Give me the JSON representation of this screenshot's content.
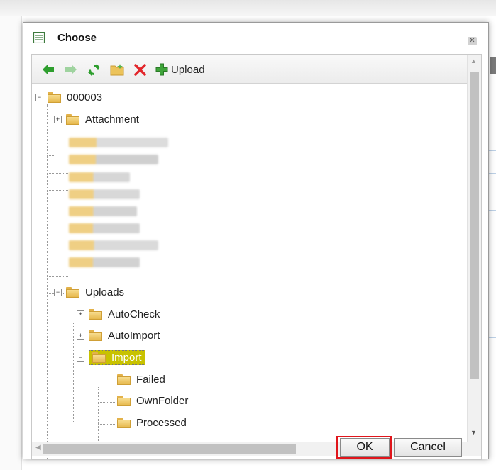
{
  "dialog": {
    "title": "Choose",
    "close_icon": "close-icon"
  },
  "toolbar": {
    "back_icon": "back-arrow-icon",
    "forward_icon": "forward-arrow-icon",
    "refresh_icon": "refresh-icon",
    "new_folder_icon": "new-folder-icon",
    "delete_icon": "delete-icon",
    "upload_label": "Upload"
  },
  "tree": {
    "root": "000003",
    "attachment": "Attachment",
    "uploads": "Uploads",
    "autocheck": "AutoCheck",
    "autoimport": "AutoImport",
    "import": "Import",
    "failed": "Failed",
    "ownfolder": "OwnFolder",
    "processed": "Processed"
  },
  "buttons": {
    "ok": "OK",
    "cancel": "Cancel"
  },
  "colors": {
    "selection": "#c8c200",
    "ok_outline": "#e0151b",
    "folder": "#e6b84d",
    "arrow_green": "#2e9e2e"
  }
}
